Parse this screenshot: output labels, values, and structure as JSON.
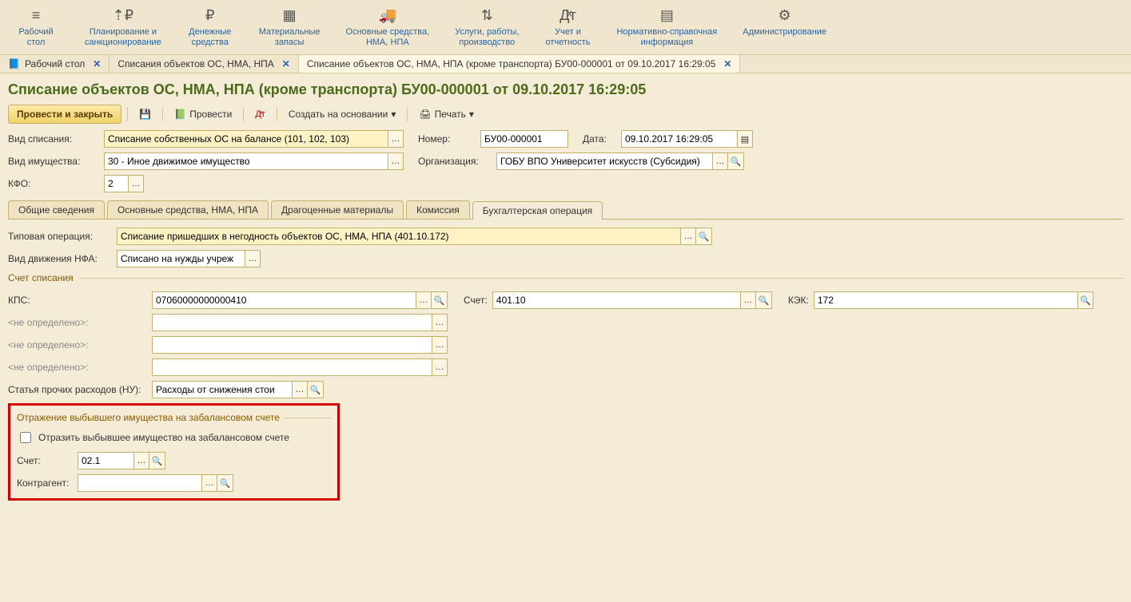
{
  "topnav": [
    {
      "label": "Рабочий\nстол"
    },
    {
      "label": "Планирование и\nсанкционирование"
    },
    {
      "label": "Денежные\nсредства"
    },
    {
      "label": "Материальные\nзапасы"
    },
    {
      "label": "Основные средства,\nНМА, НПА"
    },
    {
      "label": "Услуги, работы,\nпроизводство"
    },
    {
      "label": "Учет и\nотчетность"
    },
    {
      "label": "Нормативно-справочная\nинформация"
    },
    {
      "label": "Администрирование"
    }
  ],
  "tabs": [
    {
      "label": "Рабочий стол",
      "active": false
    },
    {
      "label": "Списания объектов ОС, НМА, НПА",
      "active": false
    },
    {
      "label": "Списание объектов ОС, НМА, НПА (кроме транспорта) БУ00-000001 от 09.10.2017 16:29:05",
      "active": true
    }
  ],
  "title": "Списание объектов ОС, НМА, НПА (кроме транспорта) БУ00-000001 от 09.10.2017 16:29:05",
  "toolbar": {
    "run_close": "Провести и закрыть",
    "run": "Провести",
    "create_based": "Создать на основании",
    "print": "Печать"
  },
  "header": {
    "writeoff_type_lbl": "Вид списания:",
    "writeoff_type": "Списание собственных ОС на балансе (101, 102, 103)",
    "number_lbl": "Номер:",
    "number": "БУ00-000001",
    "date_lbl": "Дата:",
    "date": "09.10.2017 16:29:05",
    "property_type_lbl": "Вид имущества:",
    "property_type": "30 - Иное движимое имущество",
    "org_lbl": "Организация:",
    "org": "ГОБУ ВПО Университет искусств (Субсидия)",
    "kfo_lbl": "КФО:",
    "kfo": "2"
  },
  "minitabs": [
    "Общие сведения",
    "Основные средства, НМА, НПА",
    "Драгоценные материалы",
    "Комиссия",
    "Бухгалтерская операция"
  ],
  "op": {
    "typ_lbl": "Типовая операция:",
    "typ": "Списание пришедших в негодность объектов ОС, НМА, НПА (401.10.172)",
    "move_lbl": "Вид движения НФА:",
    "move": "Списано на нужды учреж"
  },
  "acct_section": "Счет списания",
  "acct": {
    "kps_lbl": "КПС:",
    "kps": "07060000000000410",
    "schet_lbl": "Счет:",
    "schet": "401.10",
    "kek_lbl": "КЭК:",
    "kek": "172",
    "undef": "<не определено>:",
    "other_exp_lbl": "Статья прочих расходов (НУ):",
    "other_exp": "Расходы от снижения стои"
  },
  "offbal": {
    "section": "Отражение выбывшего имущества на забалансовом счете",
    "chk": "Отразить выбывшее имущество на забалансовом счете",
    "schet_lbl": "Счет:",
    "schet": "02.1",
    "contr_lbl": "Контрагент:",
    "contr": ""
  }
}
